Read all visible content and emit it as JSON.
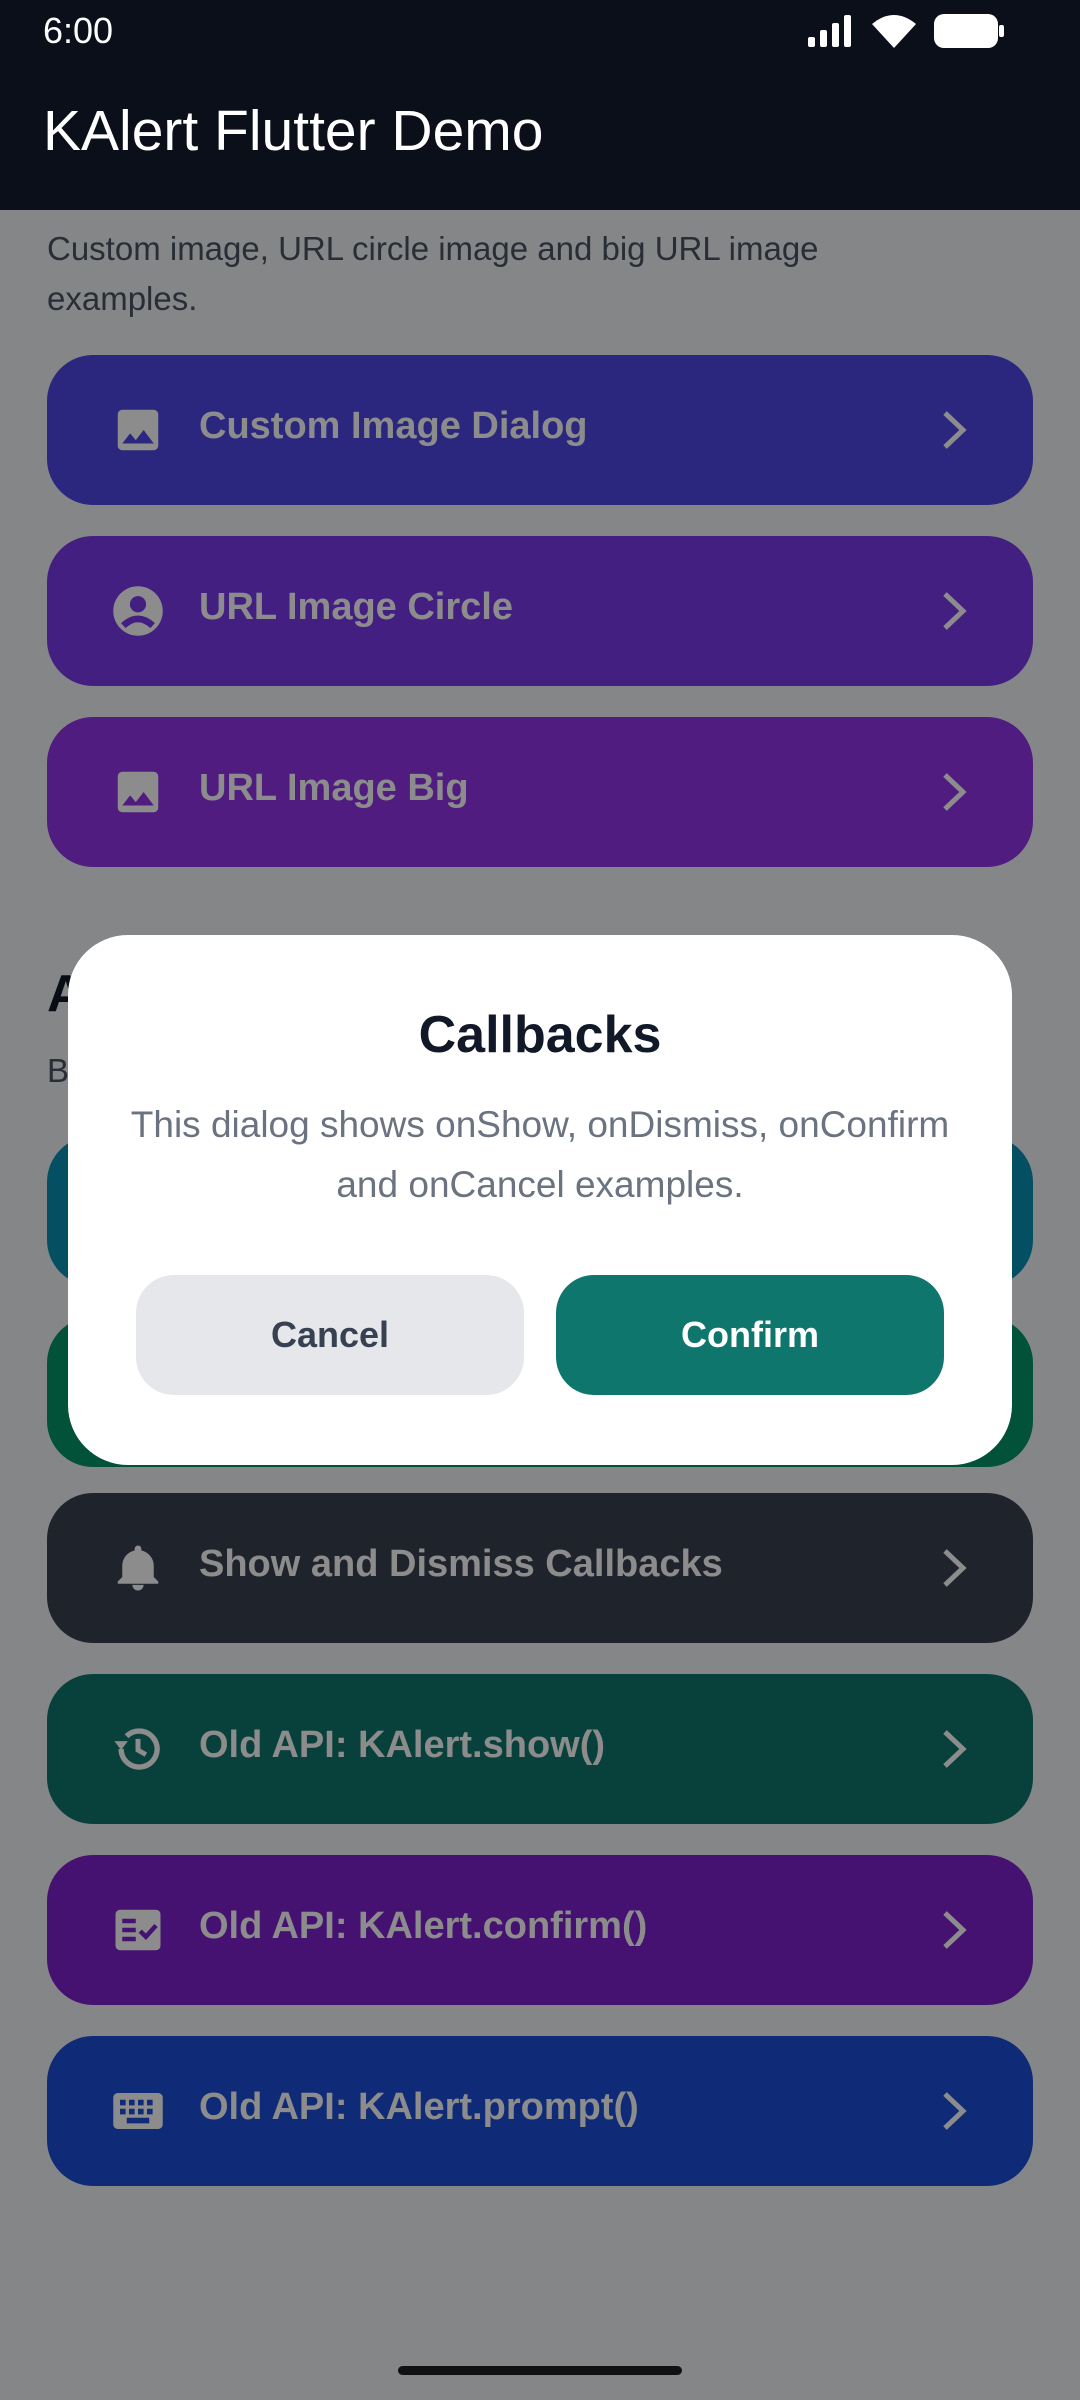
{
  "status_bar": {
    "time": "6:00"
  },
  "app_bar": {
    "title": "KAlert Flutter Demo"
  },
  "image_section": {
    "description": "Custom image, URL circle image and big URL image examples."
  },
  "callbacks_section": {
    "title": "A",
    "subtitle": "B"
  },
  "buttons": [
    {
      "label": "Custom Image Dialog",
      "icon": "image-icon",
      "color": "#4f46e5"
    },
    {
      "label": "URL Image Circle",
      "icon": "account-circle-icon",
      "color": "#7c3aed"
    },
    {
      "label": "URL Image Big",
      "icon": "image-icon",
      "color": "#9333ea"
    },
    {
      "label": "",
      "icon": "",
      "color": "#0891b2"
    },
    {
      "label": "",
      "icon": "",
      "color": "#059669"
    },
    {
      "label": "Show and Dismiss Callbacks",
      "icon": "notification-bell-icon",
      "color": "#374151"
    },
    {
      "label": "Old API: KAlert.show()",
      "icon": "history-icon",
      "color": "#0f766e"
    },
    {
      "label": "Old API: KAlert.confirm()",
      "icon": "fact-check-icon",
      "color": "#7e22ce"
    },
    {
      "label": "Old API: KAlert.prompt()",
      "icon": "keyboard-icon",
      "color": "#1d4ed8"
    }
  ],
  "dialog": {
    "title": "Callbacks",
    "message": "This dialog shows onShow, onDismiss, onConfirm and onCancel examples.",
    "cancel_label": "Cancel",
    "confirm_label": "Confirm"
  },
  "colors": {
    "appbar": "#0a0f1a",
    "confirm": "#0f766e",
    "cancel": "#e5e7eb"
  }
}
